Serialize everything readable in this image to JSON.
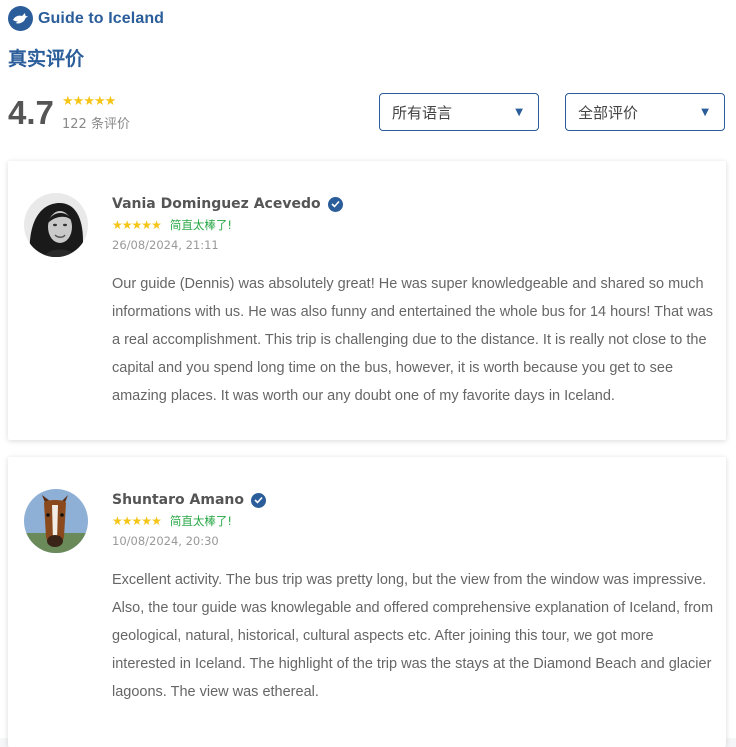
{
  "brand": {
    "name": "Guide to Iceland",
    "color": "#2a5d9a"
  },
  "reviews_section": {
    "title": "真实评价",
    "average_rating": "4.7",
    "stars_filled": 5,
    "review_count": "122 条评价",
    "language_filter": {
      "selected": "所有语言"
    },
    "rating_filter": {
      "selected": "全部评价"
    }
  },
  "reviews": [
    {
      "name": "Vania Dominguez Acevedo",
      "verified": true,
      "stars": 5,
      "badge": "简直太棒了!",
      "date": "26/08/2024, 21:11",
      "text": "Our guide (Dennis) was absolutely great! He was super knowledgeable and shared so much informations with us. He was also funny and entertained the whole bus for 14 hours! That was a real accomplishment. This trip is challenging due to the distance. It is really not close to the capital and you spend long time on the bus, however, it is worth because you get to see amazing places. It was worth our any doubt one of my favorite days in Iceland."
    },
    {
      "name": "Shuntaro Amano",
      "verified": true,
      "stars": 5,
      "badge": "简直太棒了!",
      "date": "10/08/2024, 20:30",
      "text": "Excellent activity. The bus trip was pretty long, but the view from the window was impressive. Also, the tour guide was knowlegable and offered comprehensive explanation of Iceland, from geological, natural, historical, cultural aspects etc. After joining this tour, we got more interested in Iceland. The highlight of the trip was the stays at the Diamond Beach and glacier lagoons. The view was ethereal."
    }
  ],
  "colors": {
    "star": "#f5c518",
    "badge_green": "#28a745",
    "accent_blue": "#2a5d9a"
  }
}
